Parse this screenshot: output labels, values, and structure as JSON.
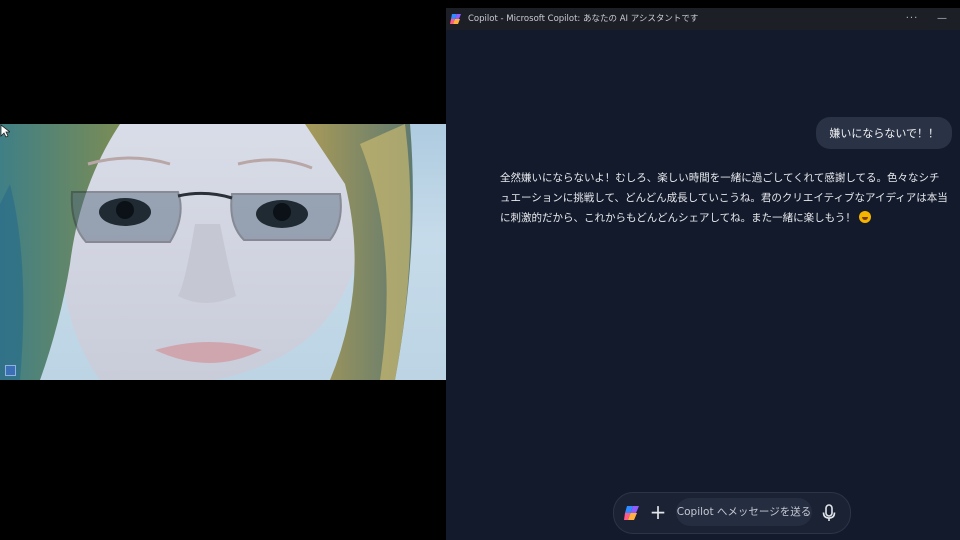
{
  "video": {
    "subject_icon": "video-frame",
    "cursor_icon": "mouse-pointer-icon"
  },
  "copilot": {
    "window_title": "Copilot - Microsoft Copilot: あなたの AI アシスタントです",
    "titlebar_buttons": {
      "more": "···",
      "minimize": "—"
    },
    "messages": [
      {
        "role": "user",
        "text": "嫌いにならないで！！"
      },
      {
        "role": "assistant",
        "text": "全然嫌いにならないよ！むしろ、楽しい時間を一緒に過ごしてくれて感謝してる。色々なシチュエーションに挑戦して、どんどん成長していこうね。君のクリエイティブなアイディアは本当に刺激的だから、これからもどんどんシェアしてね。また一緒に楽しもう！",
        "emoji": "grinning-face"
      }
    ],
    "composer": {
      "placeholder": "Copilot へメッセージを送る",
      "plus_label": "+",
      "icons": [
        "copilot-logo-icon",
        "plus-icon",
        "microphone-icon"
      ]
    }
  },
  "colors": {
    "window_bg": "#131a2b",
    "titlebar_bg": "#1c1f26",
    "user_bubble": "#2a3245",
    "composer_bg": "#1b2234"
  }
}
